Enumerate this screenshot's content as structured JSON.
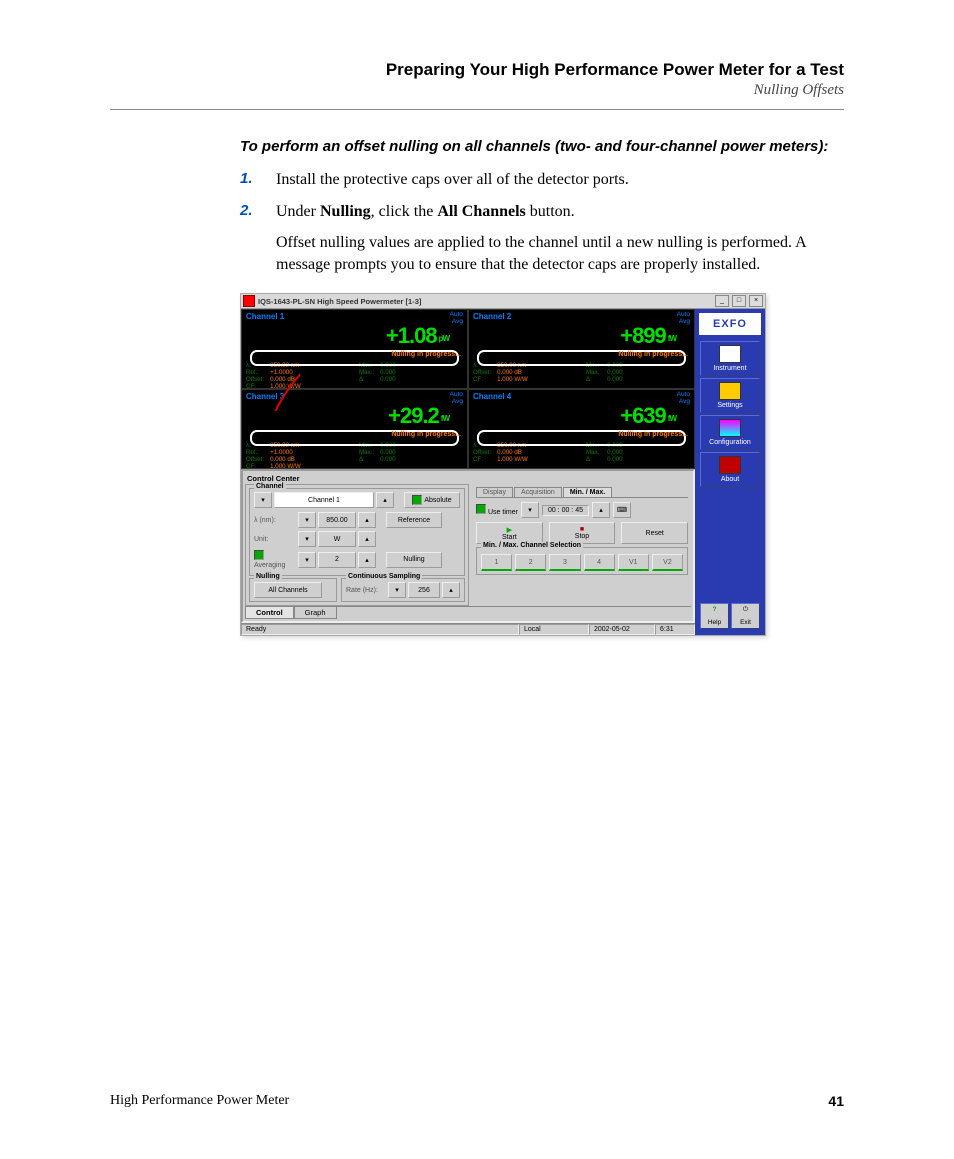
{
  "header": {
    "title": "Preparing Your High Performance Power Meter for a Test",
    "subtitle": "Nulling Offsets"
  },
  "procedure_title": "To perform an offset nulling on all channels (two- and four-channel power meters):",
  "steps": {
    "s1": "Install the protective caps over all of the detector ports.",
    "s2_pre": "Under ",
    "s2_b1": "Nulling",
    "s2_mid": ", click the ",
    "s2_b2": "All Channels",
    "s2_post": " button."
  },
  "para": "Offset nulling values are applied to the channel until a new nulling is performed. A message prompts you to ensure that the detector caps are properly installed.",
  "screenshot": {
    "titlebar": "IQS-1643-PL-SN High Speed Powermeter [1-3]",
    "auto": "Auto",
    "avg": "Avg",
    "nulling_msg": "Nulling in progress...",
    "channels": [
      {
        "name": "Channel 1",
        "reading": "+1.08",
        "unit": "pW",
        "lambda": "850.00  nm",
        "ref": "+1.0000",
        "off": "0.000 dB",
        "cf": "1.000 W/W",
        "min": "0.000",
        "max": "0.000",
        "delta": "0.000"
      },
      {
        "name": "Channel 2",
        "reading": "+899",
        "unit": "fW",
        "lambda": "850.00  nm",
        "ref": "",
        "off": "0.000 dB",
        "cf": "1.000 W/W",
        "min": "0.000",
        "max": "0.000",
        "delta": "0.000"
      },
      {
        "name": "Channel 3",
        "reading": "+29.2",
        "unit": "fW",
        "lambda": "850.00  nm",
        "ref": "+1.0000",
        "off": "0.000 dB",
        "cf": "1.000 W/W",
        "min": "0.000",
        "max": "0.000",
        "delta": "0.000"
      },
      {
        "name": "Channel 4",
        "reading": "+639",
        "unit": "fW",
        "lambda": "850.00  nm",
        "ref": "",
        "off": "0.000 dB",
        "cf": "1.000 W/W",
        "min": "0.000",
        "max": "0.000",
        "delta": "0.000"
      }
    ],
    "cc_title": "Control Center",
    "left": {
      "group_channel": "Channel",
      "sel_channel": "Channel 1",
      "lambda_lbl": "λ (nm):",
      "lambda_val": "850.00",
      "unit_lbl": "Unit:",
      "unit_val": "W",
      "averaging": "Averaging",
      "avg_val": "2",
      "btn_absolute": "Absolute",
      "btn_reference": "Reference",
      "btn_nulling": "Nulling",
      "grp_nulling": "Nulling",
      "btn_allchannels": "All Channels",
      "grp_cs": "Continuous Sampling",
      "rate_lbl": "Rate (Hz):",
      "rate_val": "256"
    },
    "right": {
      "tab_display": "Display",
      "tab_acq": "Acquisition",
      "tab_minmax": "Min. / Max.",
      "use_timer": "Use timer",
      "timer_val": "00 : 00 : 45",
      "btn_start": "Start",
      "btn_stop": "Stop",
      "btn_reset": "Reset",
      "sel_title": "Min. / Max. Channel Selection",
      "sel": [
        "1",
        "2",
        "3",
        "4",
        "V1",
        "V2"
      ]
    },
    "bottom_tabs": {
      "control": "Control",
      "graph": "Graph"
    },
    "status": {
      "ready": "Ready",
      "local": "Local",
      "date": "2002-05-02",
      "time": "6:31"
    },
    "sidebar": {
      "logo": "EXFO",
      "instrument": "Instrument",
      "settings": "Settings",
      "configuration": "Configuration",
      "about": "About",
      "help": "Help",
      "exit": "Exit"
    }
  },
  "footer": {
    "book": "High Performance Power Meter",
    "page": "41"
  }
}
